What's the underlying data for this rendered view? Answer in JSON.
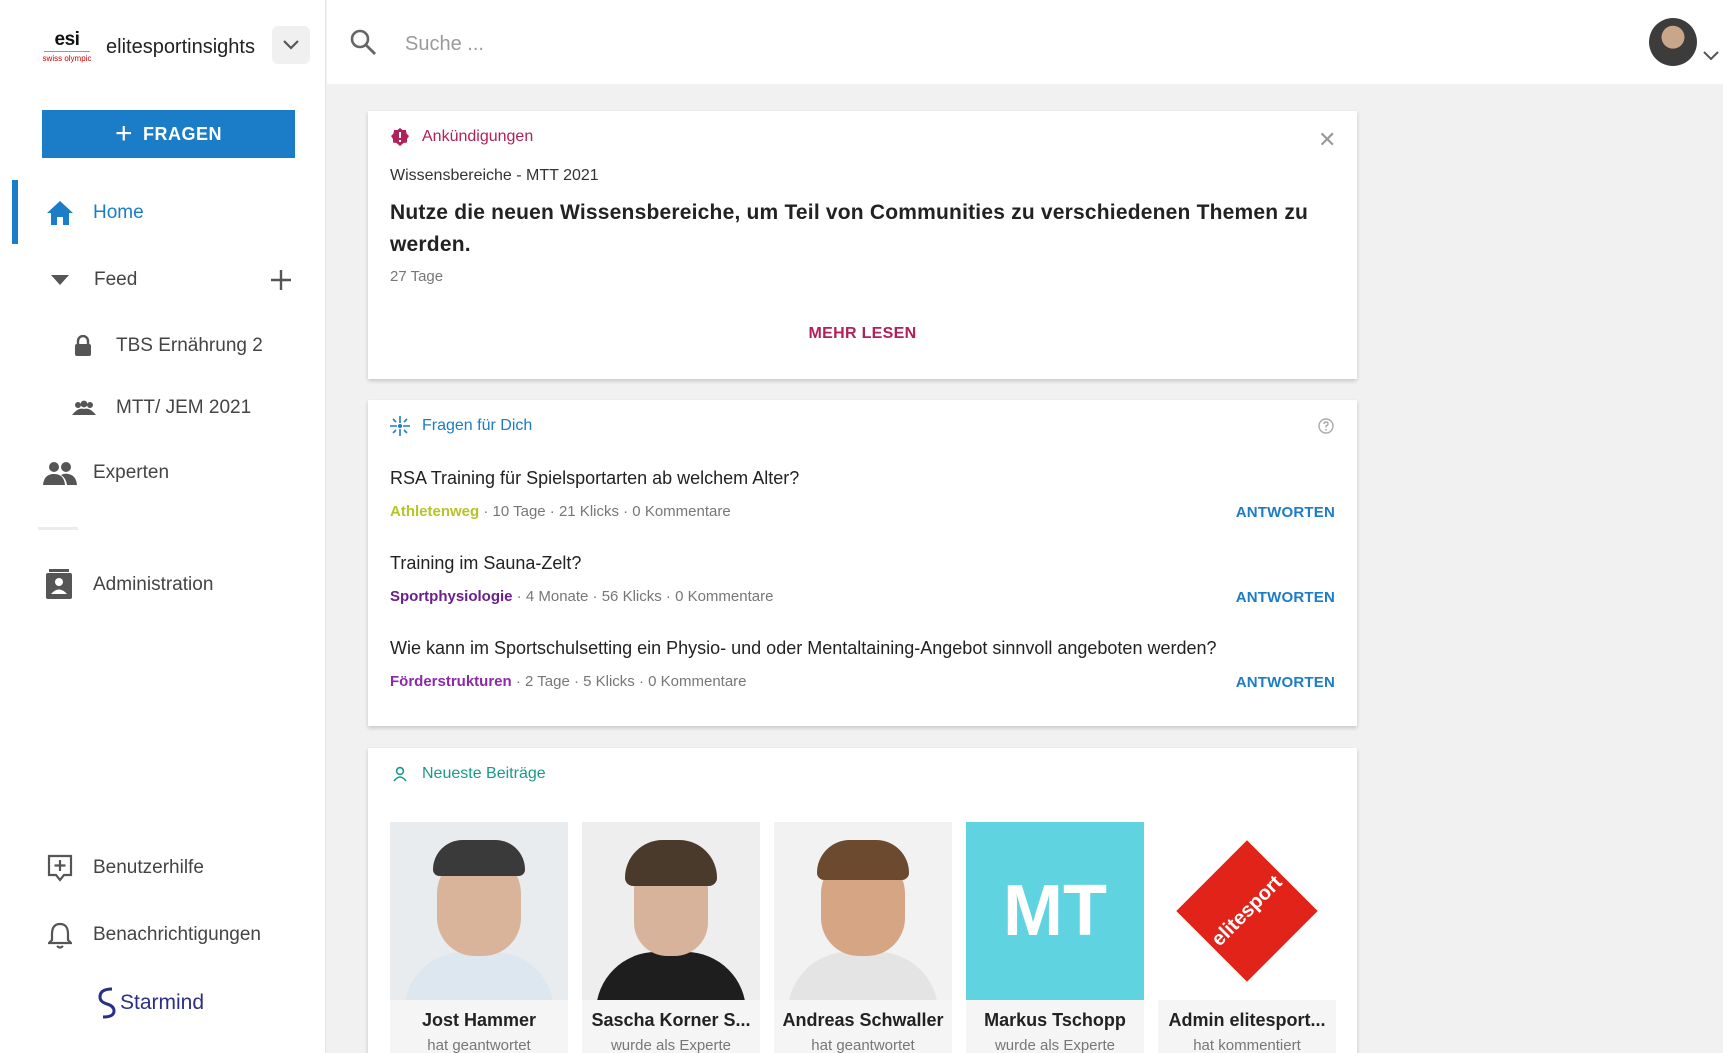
{
  "brand": {
    "logo_text": "esi",
    "logo_sub": "swiss olympic",
    "name": "elitesportinsights"
  },
  "sidebar": {
    "ask_label": "FRAGEN",
    "items": [
      {
        "label": "Home"
      },
      {
        "label": "Feed"
      },
      {
        "label": "TBS Ernährung 2"
      },
      {
        "label": "MTT/ JEM 2021"
      },
      {
        "label": "Experten"
      },
      {
        "label": "Administration"
      },
      {
        "label": "Benutzerhilfe"
      },
      {
        "label": "Benachrichtigungen"
      }
    ],
    "footer_brand": "Starmind"
  },
  "search": {
    "placeholder": "Suche ..."
  },
  "colors": {
    "primary": "#1b7cc8",
    "announcement": "#b0205a",
    "recent": "#1a9a8a"
  },
  "announcement": {
    "heading": "Ankündigungen",
    "subtitle": "Wissensbereiche - MTT 2021",
    "title": "Nutze die neuen Wissensbereiche, um Teil von Communities zu verschiedenen Themen zu werden.",
    "age": "27 Tage",
    "more": "MEHR LESEN"
  },
  "questions": {
    "heading": "Fragen für Dich",
    "answer_label": "ANTWORTEN",
    "items": [
      {
        "title": "RSA Training für Spielsportarten ab welchem Alter?",
        "category": "Athletenweg",
        "category_color": "#b5c526",
        "meta": " · 10 Tage · 21 Klicks · 0 Kommentare"
      },
      {
        "title": "Training im Sauna-Zelt?",
        "category": "Sportphysiologie",
        "category_color": "#6a1f8f",
        "meta": " · 4 Monate · 56 Klicks · 0 Kommentare"
      },
      {
        "title": "Wie kann im Sportschulsetting ein Physio- und oder Mentaltaining-Angebot sinnvoll angeboten werden?",
        "category": "Förderstrukturen",
        "category_color": "#8a2aa8",
        "meta": " · 2 Tage · 5 Klicks · 0 Kommentare"
      }
    ]
  },
  "recent": {
    "heading": "Neueste Beiträge",
    "people": [
      {
        "name": "Jost Hammer",
        "action": "hat geantwortet"
      },
      {
        "name": "Sascha Korner S...",
        "action": "wurde als Experte"
      },
      {
        "name": "Andreas Schwaller",
        "action": "hat geantwortet"
      },
      {
        "name": "Markus Tschopp",
        "action": "wurde als Experte",
        "initials": "MT"
      },
      {
        "name": "Admin elitesport...",
        "action": "hat kommentiert",
        "logo_text": "elitesport"
      }
    ]
  }
}
